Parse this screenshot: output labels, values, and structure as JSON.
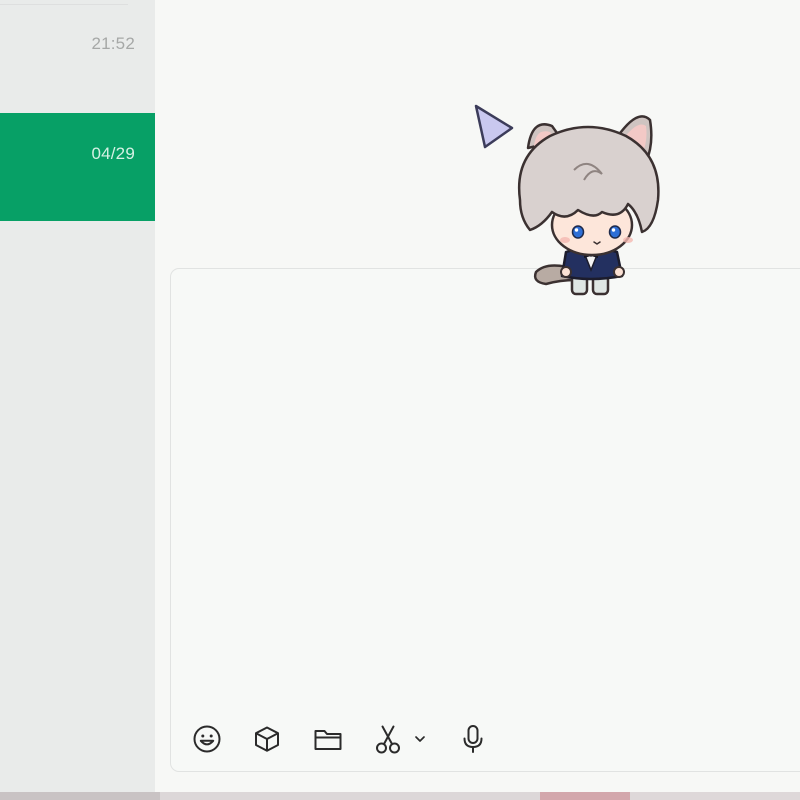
{
  "chat_list": {
    "items": [
      {
        "time": "21:52",
        "selected": false
      },
      {
        "time": "04/29",
        "selected": true
      }
    ]
  },
  "toolbar": {
    "buttons": [
      {
        "icon": "smiley-icon"
      },
      {
        "icon": "cube-icon"
      },
      {
        "icon": "folder-icon"
      },
      {
        "icon": "scissors-icon"
      },
      {
        "icon": "chevron-down-icon"
      },
      {
        "icon": "microphone-icon"
      }
    ]
  },
  "colors": {
    "selected_item": "#07a066",
    "list_background": "#e9ebea",
    "page_background": "#f7f8f6",
    "icon_stroke": "#2b2b2b"
  }
}
